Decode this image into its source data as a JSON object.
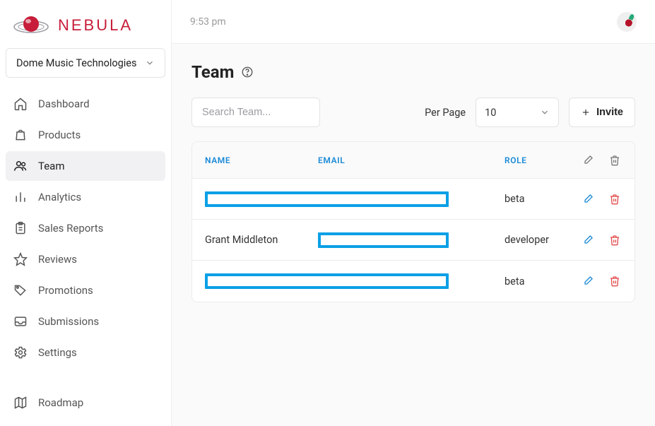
{
  "brand": {
    "name": "NEBULA"
  },
  "org": {
    "name": "Dome Music Technologies"
  },
  "topbar": {
    "time": "9:53 pm"
  },
  "sidebar": {
    "items": [
      {
        "label": "Dashboard"
      },
      {
        "label": "Products"
      },
      {
        "label": "Team"
      },
      {
        "label": "Analytics"
      },
      {
        "label": "Sales Reports"
      },
      {
        "label": "Reviews"
      },
      {
        "label": "Promotions"
      },
      {
        "label": "Submissions"
      },
      {
        "label": "Settings"
      }
    ],
    "footer": {
      "label": "Roadmap"
    }
  },
  "page": {
    "title": "Team"
  },
  "controls": {
    "search_placeholder": "Search Team...",
    "perpage_label": "Per Page",
    "perpage_value": "10",
    "invite_label": "Invite"
  },
  "table": {
    "headers": {
      "name": "NAME",
      "email": "EMAIL",
      "role": "ROLE"
    },
    "rows": [
      {
        "name": "",
        "email": "",
        "role": "beta",
        "name_redacted": true,
        "email_redacted": true,
        "combined_redact": true
      },
      {
        "name": "Grant Middleton",
        "email": "",
        "role": "developer",
        "name_redacted": false,
        "email_redacted": true,
        "combined_redact": false
      },
      {
        "name": "",
        "email": "",
        "role": "beta",
        "name_redacted": true,
        "email_redacted": true,
        "combined_redact": true
      }
    ]
  }
}
